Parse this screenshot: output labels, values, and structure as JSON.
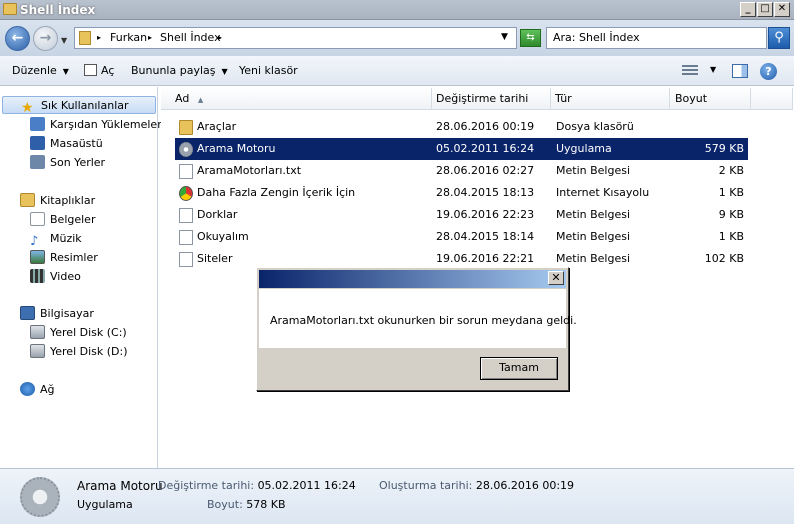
{
  "window": {
    "title": "Shell İndex"
  },
  "caption": {
    "minimize": "_",
    "maximize": "□",
    "close": "✕"
  },
  "address": {
    "crumbs": [
      "Furkan",
      "Shell İndex"
    ],
    "search_placeholder": "Ara: Shell İndex"
  },
  "toolbar": {
    "organize": "Düzenle",
    "open": "Aç",
    "share": "Bununla paylaş",
    "new_folder": "Yeni klasör"
  },
  "nav": {
    "favorites": {
      "label": "Sık Kullanılanlar",
      "items": [
        "Karşıdan Yüklemeler",
        "Masaüstü",
        "Son Yerler"
      ]
    },
    "libraries": {
      "label": "Kitaplıklar",
      "items": [
        "Belgeler",
        "Müzik",
        "Resimler",
        "Video"
      ]
    },
    "computer": {
      "label": "Bilgisayar",
      "items": [
        "Yerel Disk (C:)",
        "Yerel Disk (D:)"
      ]
    },
    "network": {
      "label": "Ağ"
    }
  },
  "columns": {
    "name": "Ad",
    "date": "Değiştirme tarihi",
    "type": "Tür",
    "size": "Boyut"
  },
  "files": [
    {
      "name": "Araçlar",
      "date": "28.06.2016 00:19",
      "type": "Dosya klasörü",
      "size": "",
      "icon": "folder-icon"
    },
    {
      "name": "Arama Motoru",
      "date": "05.02.2011 16:24",
      "type": "Uygulama",
      "size": "579 KB",
      "icon": "gear-icon",
      "selected": true
    },
    {
      "name": "AramaMotorları.txt",
      "date": "28.06.2016 02:27",
      "type": "Metin Belgesi",
      "size": "2 KB",
      "icon": "document-icon"
    },
    {
      "name": "Daha Fazla Zengin İçerik İçin",
      "date": "28.04.2015 18:13",
      "type": "Internet Kısayolu",
      "size": "1 KB",
      "icon": "chrome-icon"
    },
    {
      "name": "Dorklar",
      "date": "19.06.2016 22:23",
      "type": "Metin Belgesi",
      "size": "9 KB",
      "icon": "document-icon"
    },
    {
      "name": "Okuyalım",
      "date": "28.04.2015 18:14",
      "type": "Metin Belgesi",
      "size": "1 KB",
      "icon": "document-icon"
    },
    {
      "name": "Siteler",
      "date": "19.06.2016 22:21",
      "type": "Metin Belgesi",
      "size": "102 KB",
      "icon": "document-icon"
    }
  ],
  "dialog": {
    "close": "✕",
    "message": "AramaMotorları.txt okunurken bir sorun meydana geldi.",
    "ok": "Tamam"
  },
  "details": {
    "name": "Arama Motoru",
    "type": "Uygulama",
    "modified_label": "Değiştirme tarihi:",
    "modified": "05.02.2011 16:24",
    "size_label": "Boyut:",
    "size": "578 KB",
    "created_label": "Oluşturma tarihi:",
    "created": "28.06.2016 00:19"
  }
}
